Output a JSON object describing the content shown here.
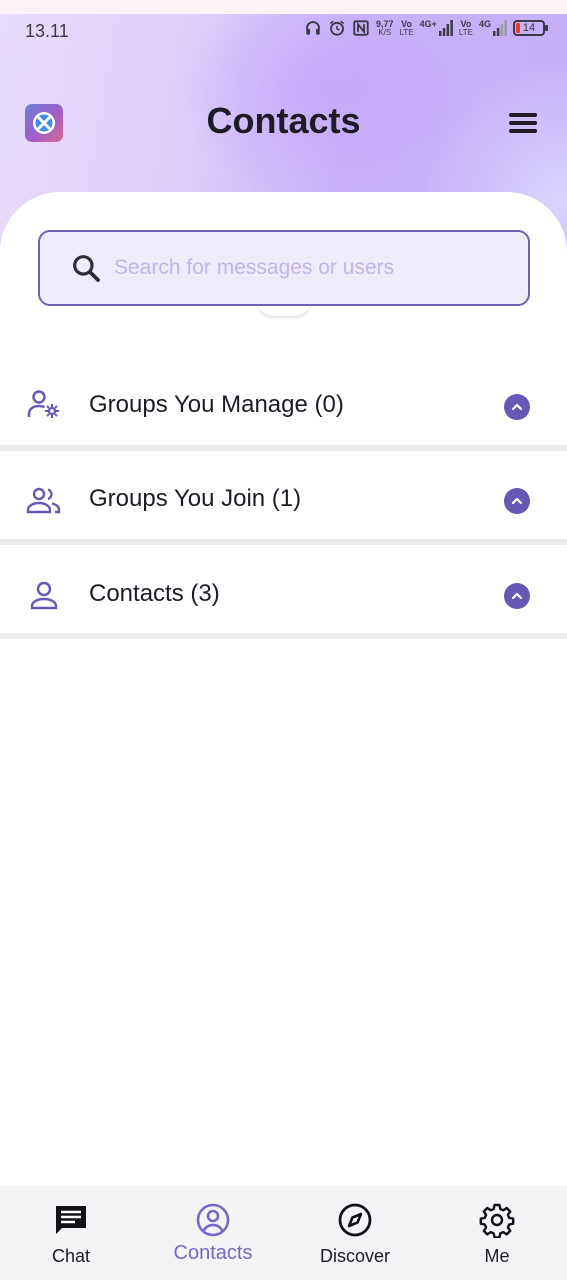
{
  "status_bar": {
    "time": "13.11",
    "net_speed": "9,77",
    "net_speed_unit": "K/S",
    "volte_1": "Vo",
    "volte_1_sub": "LTE",
    "network_1": "4G+",
    "volte_2": "Vo",
    "volte_2_sub": "LTE",
    "network_2": "4G",
    "battery": "14"
  },
  "header": {
    "title": "Contacts"
  },
  "search": {
    "placeholder": "Search for messages or users",
    "value": ""
  },
  "sections": [
    {
      "label": "Groups You Manage (0)",
      "icon": "group-settings-icon",
      "expanded": true
    },
    {
      "label": "Groups You Join (1)",
      "icon": "group-icon",
      "expanded": true
    },
    {
      "label": "Contacts (3)",
      "icon": "person-icon",
      "expanded": true
    }
  ],
  "bottom_nav": {
    "items": [
      {
        "label": "Chat",
        "icon": "chat-icon",
        "active": false
      },
      {
        "label": "Contacts",
        "icon": "account-circle-icon",
        "active": true
      },
      {
        "label": "Discover",
        "icon": "compass-icon",
        "active": false
      },
      {
        "label": "Me",
        "icon": "gear-icon",
        "active": false
      }
    ]
  },
  "colors": {
    "accent": "#6957b6",
    "active_nav": "#7a68c4",
    "search_border": "#6c63ad",
    "search_bg": "#efebfb",
    "battery_low": "#e53935"
  }
}
